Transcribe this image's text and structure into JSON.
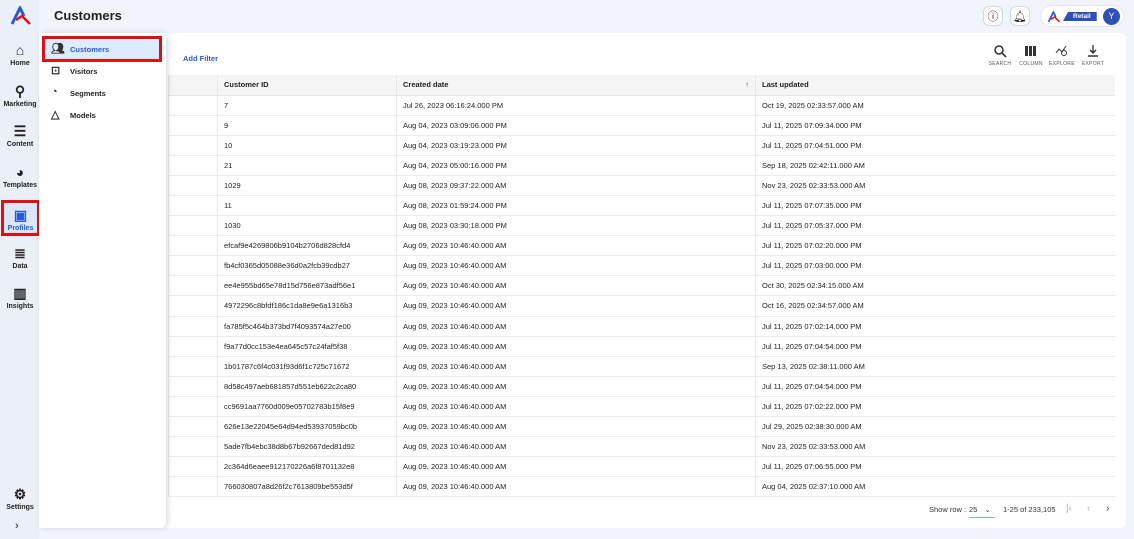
{
  "header": {
    "title": "Customers",
    "account_badge": "Retail",
    "avatar_initial": "Y"
  },
  "rail": {
    "items": [
      {
        "label": "Home",
        "icon": "home-icon"
      },
      {
        "label": "Marketing",
        "icon": "route-icon"
      },
      {
        "label": "Content",
        "icon": "document-icon"
      },
      {
        "label": "Templates",
        "icon": "palette-icon"
      },
      {
        "label": "Profiles",
        "icon": "profile-card-icon",
        "active": true
      },
      {
        "label": "Data",
        "icon": "database-icon"
      },
      {
        "label": "Insights",
        "icon": "chart-icon"
      }
    ],
    "settings": "Settings"
  },
  "flyout": {
    "items": [
      {
        "label": "Customers",
        "active": true
      },
      {
        "label": "Visitors"
      },
      {
        "label": "Segments"
      },
      {
        "label": "Models"
      }
    ]
  },
  "toolbar": {
    "add_filter": "Add Filter",
    "tools": [
      "SEARCH",
      "COLUMN",
      "EXPLORE",
      "EXPORT"
    ]
  },
  "table": {
    "columns": [
      "",
      "Customer ID",
      "Created date",
      "Last updated"
    ],
    "sort": "Created date ascending",
    "rows": [
      [
        "7",
        "Jul 26, 2023 06:16:24.000 PM",
        "Oct 19, 2025 02:33:57.000 AM"
      ],
      [
        "9",
        "Aug 04, 2023 03:09:06.000 PM",
        "Jul 11, 2025 07:09:34.000 PM"
      ],
      [
        "10",
        "Aug 04, 2023 03:19:23.000 PM",
        "Jul 11, 2025 07:04:51.000 PM"
      ],
      [
        "21",
        "Aug 04, 2023 05:00:16.000 PM",
        "Sep 18, 2025 02:42:11.000 AM"
      ],
      [
        "1029",
        "Aug 08, 2023 09:37:22.000 AM",
        "Nov 23, 2025 02:33:53.000 AM"
      ],
      [
        "11",
        "Aug 08, 2023 01:59:24.000 PM",
        "Jul 11, 2025 07:07:35.000 PM"
      ],
      [
        "1030",
        "Aug 08, 2023 03:30:18.000 PM",
        "Jul 11, 2025 07:05:37.000 PM"
      ],
      [
        "efcaf9e4269806b9104b2706d828cfd4",
        "Aug 09, 2023 10:46:40.000 AM",
        "Jul 11, 2025 07:02:20.000 PM"
      ],
      [
        "fb4cf0365d05088e36d0a2fcb39cdb27",
        "Aug 09, 2023 10:46:40.000 AM",
        "Jul 11, 2025 07:03:00.000 PM"
      ],
      [
        "ee4e955bd65e78d15d756e873adf56e1",
        "Aug 09, 2023 10:46:40.000 AM",
        "Oct 30, 2025 02:34:15.000 AM"
      ],
      [
        "4972296c8bfdf186c1da8e9e6a1316b3",
        "Aug 09, 2023 10:46:40.000 AM",
        "Oct 16, 2025 02:34:57.000 AM"
      ],
      [
        "fa785f5c464b373bd7f4093574a27e00",
        "Aug 09, 2023 10:46:40.000 AM",
        "Jul 11, 2025 07:02:14.000 PM"
      ],
      [
        "f9a77d0cc153e4ea645c57c24faf5f38",
        "Aug 09, 2023 10:46:40.000 AM",
        "Jul 11, 2025 07:04:54.000 PM"
      ],
      [
        "1b01787c6f4c031f93d6f1c725c71672",
        "Aug 09, 2023 10:46:40.000 AM",
        "Sep 13, 2025 02:38:11.000 AM"
      ],
      [
        "8d58c497aeb681857d551eb622c2ca80",
        "Aug 09, 2023 10:46:40.000 AM",
        "Jul 11, 2025 07:04:54.000 PM"
      ],
      [
        "cc9691aa7760d009e05702783b15f8e9",
        "Aug 09, 2023 10:46:40.000 AM",
        "Jul 11, 2025 07:02:22.000 PM"
      ],
      [
        "626e13e22045e64d94ed53937059bc0b",
        "Aug 09, 2023 10:46:40.000 AM",
        "Jul 29, 2025 02:38:30.000 AM"
      ],
      [
        "5ade7fb4ebc38d8b67b92667ded81d92",
        "Aug 09, 2023 10:46:40.000 AM",
        "Nov 23, 2025 02:33:53.000 AM"
      ],
      [
        "2c364d6eaee912170226a6f8701132e8",
        "Aug 09, 2023 10:46:40.000 AM",
        "Jul 11, 2025 07:06:55.000 PM"
      ],
      [
        "766030807a8d26f2c7613809be553d5f",
        "Aug 09, 2023 10:46:40.000 AM",
        "Aug 04, 2025 02:37:10.000 AM"
      ]
    ]
  },
  "pagination": {
    "show_row_label": "Show row :",
    "rows_per_page": "25",
    "range": "1-25 of 233,105"
  },
  "colors": {
    "accent": "#2a5bd7",
    "highlight": "#e01010"
  }
}
